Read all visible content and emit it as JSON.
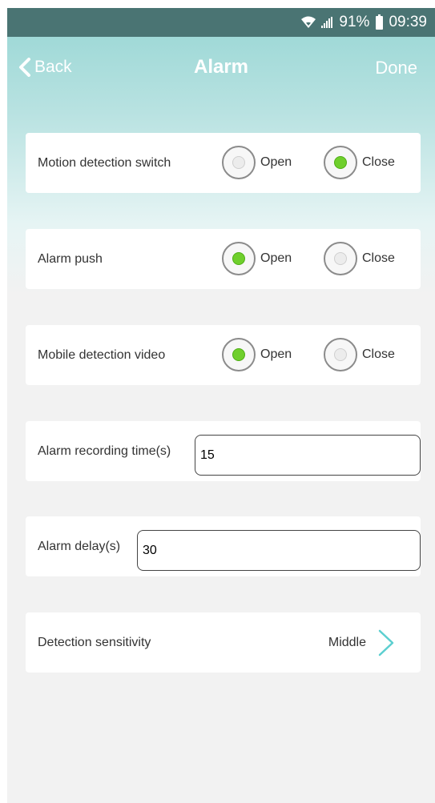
{
  "status_bar": {
    "battery": "91%",
    "time": "09:39"
  },
  "nav": {
    "back_label": "Back",
    "title": "Alarm",
    "done_label": "Done"
  },
  "settings": {
    "motion_detection": {
      "label": "Motion detection switch",
      "option_open": "Open",
      "option_close": "Close",
      "selected": "Close"
    },
    "alarm_push": {
      "label": "Alarm push",
      "option_open": "Open",
      "option_close": "Close",
      "selected": "Open"
    },
    "mobile_detection_video": {
      "label": "Mobile detection video",
      "option_open": "Open",
      "option_close": "Close",
      "selected": "Open"
    },
    "alarm_recording_time": {
      "label": "Alarm recording time(s)",
      "value": "15"
    },
    "alarm_delay": {
      "label": "Alarm delay(s)",
      "value": "30"
    },
    "detection_sensitivity": {
      "label": "Detection sensitivity",
      "value": "Middle"
    }
  },
  "colors": {
    "accent": "#5ccfd0",
    "selected_radio": "#6fcf2c",
    "header": "#97d6d4"
  }
}
